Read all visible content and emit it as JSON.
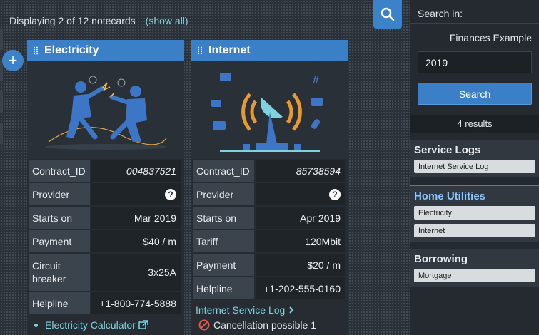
{
  "topbar": {
    "displaying": "Displaying 2 of 12 notecards",
    "show_all": "(show all)"
  },
  "add_button": "+",
  "cards": [
    {
      "title": "Electricity",
      "rows": [
        {
          "label": "Contract_ID",
          "value": "004837521",
          "italic": true
        },
        {
          "label": "Provider",
          "value": "?"
        },
        {
          "label": "Starts on",
          "value": "Mar 2019"
        },
        {
          "label": "Payment",
          "value": "$40 / m"
        },
        {
          "label": "Circuit breaker",
          "value": "3x25A"
        },
        {
          "label": "Helpline",
          "value": "+1-800-774-5888"
        }
      ],
      "link": "Electricity Calculator"
    },
    {
      "title": "Internet",
      "rows": [
        {
          "label": "Contract_ID",
          "value": "85738594",
          "italic": true
        },
        {
          "label": "Provider",
          "value": "?"
        },
        {
          "label": "Starts on",
          "value": "Apr 2019"
        },
        {
          "label": "Tariff",
          "value": "120Mbit"
        },
        {
          "label": "Payment",
          "value": "$20 / m"
        },
        {
          "label": "Helpline",
          "value": "+1-202-555-0160"
        }
      ],
      "link": "Internet Service Log",
      "cancel": "Cancellation possible 1"
    }
  ],
  "sidebar": {
    "title": "Search in:",
    "collection": "Finances Example",
    "query": "2019",
    "search_label": "Search",
    "results": "4 results",
    "groups": [
      {
        "title": "Service Logs",
        "items": [
          "Internet Service Log"
        ]
      },
      {
        "title": "Home Utilities",
        "items": [
          "Electricity",
          "Internet"
        ]
      },
      {
        "title": "Borrowing",
        "items": [
          "Mortgage"
        ]
      }
    ]
  },
  "colors": {
    "accent": "#3b82c9",
    "link": "#7fd3df",
    "background": "#2b3138"
  }
}
